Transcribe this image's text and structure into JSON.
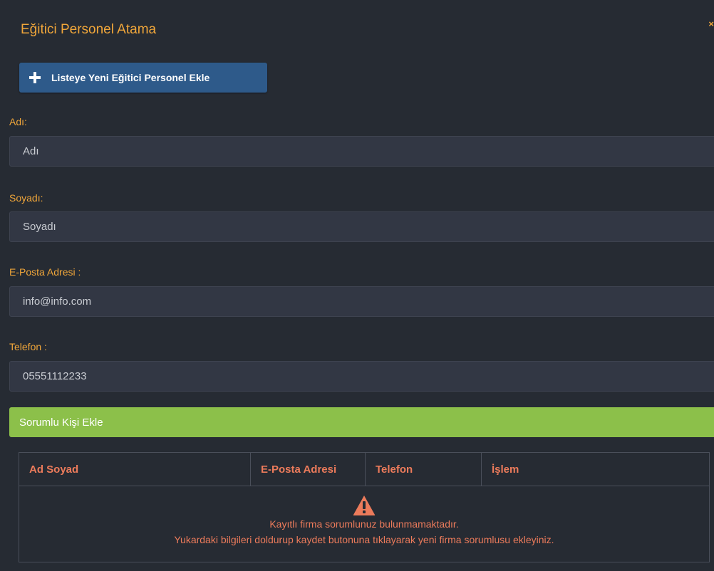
{
  "modal": {
    "title": "Eğitici Personel Atama",
    "close_label": "×"
  },
  "add_button": {
    "icon": "plus-icon",
    "label": "Listeye Yeni Eğitici Personel Ekle"
  },
  "form": {
    "name": {
      "label": "Adı:",
      "placeholder": "Adı"
    },
    "surname": {
      "label": "Soyadı:",
      "placeholder": "Soyadı"
    },
    "email": {
      "label": "E-Posta Adresi :",
      "placeholder": "info@info.com"
    },
    "phone": {
      "label": "Telefon :",
      "placeholder": "05551112233"
    }
  },
  "add_responsible": {
    "label": "Sorumlu Kişi Ekle"
  },
  "table": {
    "headers": [
      "Ad Soyad",
      "E-Posta Adresi",
      "Telefon",
      "İşlem"
    ],
    "empty_icon": "warning-icon",
    "empty_line1": "Kayıtlı firma sorumlunuz bulunmamaktadır.",
    "empty_line2": "Yukardaki bilgileri doldurup kaydet butonuna tıklayarak yeni firma sorumlusu ekleyiniz."
  },
  "colors": {
    "background": "#262b33",
    "accent_orange": "#f0a63a",
    "header_red": "#ec7b5b",
    "primary_button": "#2e5a8a",
    "success_bar": "#8cc04a"
  }
}
